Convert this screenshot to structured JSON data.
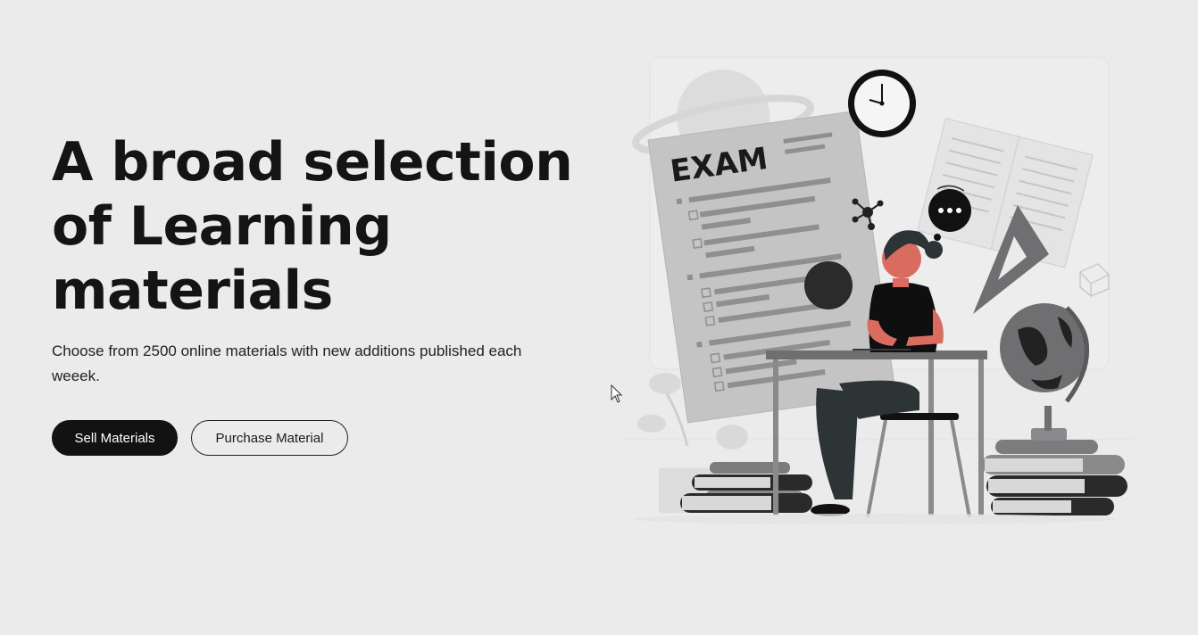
{
  "hero": {
    "headline_lines": [
      "A broad selection",
      "of Learning",
      "materials"
    ],
    "subtitle": "Choose from 2500 online materials with new additions published each weeek."
  },
  "buttons": {
    "sell_label": "Sell Materials",
    "purchase_label": "Purchase Material"
  },
  "illustration": {
    "exam_label": "EXAM",
    "icons": [
      "clock-icon",
      "open-book-icon",
      "chat-bubble-icon",
      "triangle-ruler-icon",
      "globe-icon",
      "planet-icon",
      "molecule-icon",
      "cube-icon",
      "plant-icon"
    ]
  },
  "colors": {
    "background": "#ebebec",
    "button_dark": "#121212",
    "text": "#141414"
  }
}
